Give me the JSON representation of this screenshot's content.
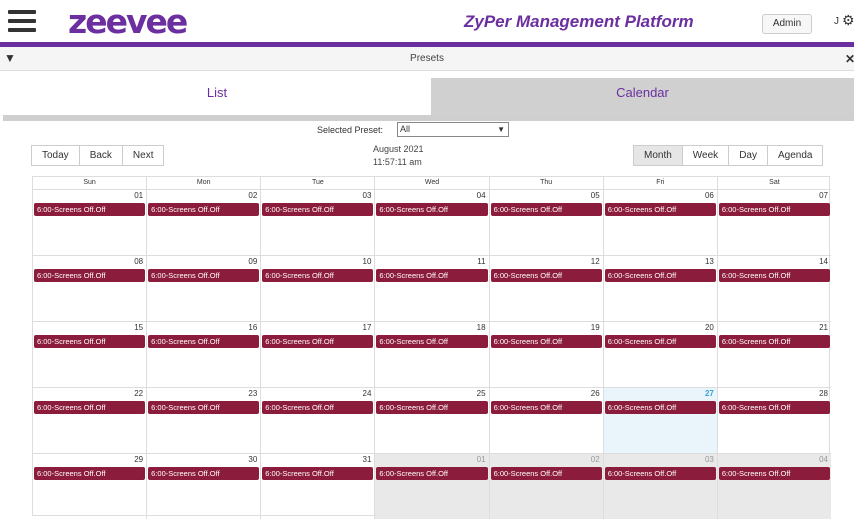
{
  "header": {
    "logo": "zeevee",
    "title": "ZyPer Management Platform",
    "admin_label": "Admin",
    "user_initial": "J"
  },
  "presets_bar": {
    "title": "Presets"
  },
  "tabs": [
    {
      "label": "List"
    },
    {
      "label": "Calendar"
    }
  ],
  "preset": {
    "label": "Selected Preset:",
    "value": "All"
  },
  "nav": {
    "today": "Today",
    "back": "Back",
    "next": "Next"
  },
  "date": {
    "month": "August 2021",
    "time": "11:57:11 am"
  },
  "views": [
    {
      "label": "Month",
      "active": true
    },
    {
      "label": "Week",
      "active": false
    },
    {
      "label": "Day",
      "active": false
    },
    {
      "label": "Agenda",
      "active": false
    }
  ],
  "calendar": {
    "weekdays": [
      "Sun",
      "Mon",
      "Tue",
      "Wed",
      "Thu",
      "Fri",
      "Sat"
    ],
    "event_label": "6:00-Screens Off.Off",
    "event_color": "#8b1c3b",
    "weeks": [
      [
        "01",
        "02",
        "03",
        "04",
        "05",
        "06",
        "07"
      ],
      [
        "08",
        "09",
        "10",
        "11",
        "12",
        "13",
        "14"
      ],
      [
        "15",
        "16",
        "17",
        "18",
        "19",
        "20",
        "21"
      ],
      [
        "22",
        "23",
        "24",
        "25",
        "26",
        "27",
        "28"
      ],
      [
        "29",
        "30",
        "31",
        "01",
        "02",
        "03",
        "04"
      ]
    ],
    "today": "27",
    "off_range_days": [
      "01",
      "02",
      "03",
      "04"
    ]
  }
}
